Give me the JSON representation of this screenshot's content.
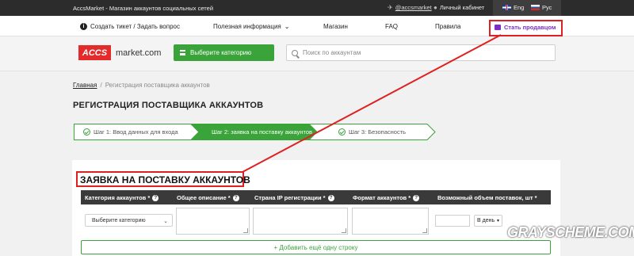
{
  "topbar": {
    "site_title": "AccsMarket - Магазин аккаунтов социальных сетей",
    "telegram": "@accsmarket",
    "cabinet": "Личный кабинет",
    "lang_en": "Eng",
    "lang_ru": "Рус"
  },
  "nav": {
    "ticket": "Создать тикет / Задать вопрос",
    "info": "Полезная информация",
    "shop": "Магазин",
    "faq": "FAQ",
    "rules": "Правила",
    "seller": "Стать продавцом"
  },
  "header": {
    "logo_accs": "ACCS",
    "logo_market": "market.com",
    "category_button": "Выберите категорию",
    "search_placeholder": "Поиск по аккаунтам"
  },
  "breadcrumb": {
    "home": "Главная",
    "sep": "/",
    "current": "Регистрация поставщика аккаунтов"
  },
  "page_title": "РЕГИСТРАЦИЯ ПОСТАВЩИКА АККАУНТОВ",
  "steps": [
    {
      "label": "Шаг 1: Ввод данных для входа"
    },
    {
      "label": "Шаг 2: заявка на поставку аккаунтов"
    },
    {
      "label": "Шаг 3: Безопасность"
    }
  ],
  "form": {
    "title": "ЗАЯВКА НА ПОСТАВКУ АККАУНТОВ",
    "columns": [
      {
        "label": "Категория аккаунтов *"
      },
      {
        "label": "Общее описание *"
      },
      {
        "label": "Страна IP регистрации *"
      },
      {
        "label": "Формат аккаунтов *"
      },
      {
        "label": "Возможный объем поставок, шт *"
      }
    ],
    "category_select": "Выберите категорию",
    "period_select": "В день",
    "add_row": "+ Добавить ещё одну строку"
  },
  "watermark": "GRAYSCHEME.COM",
  "colors": {
    "accent_red": "#e02020",
    "green": "#3aa33a",
    "seller_purple": "#7a2fc9",
    "dark": "#2c2c2c"
  }
}
